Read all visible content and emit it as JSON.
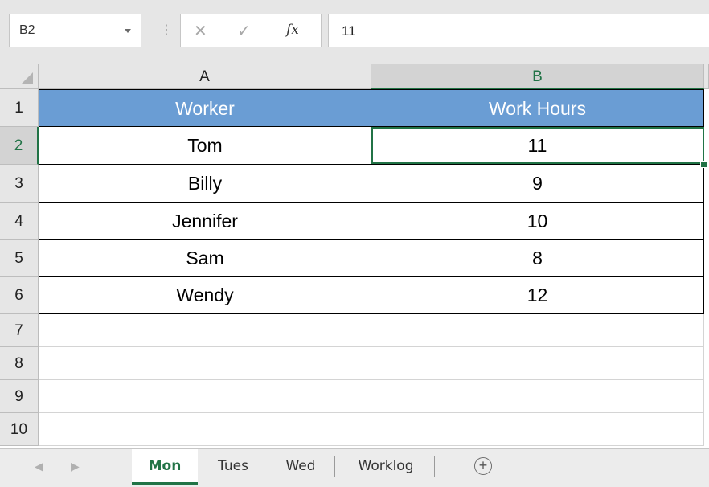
{
  "formula_bar": {
    "name_box": "B2",
    "cancel_symbol": "✕",
    "enter_symbol": "✓",
    "fx_label": "fx",
    "formula_value": "11"
  },
  "columns": [
    "A",
    "B"
  ],
  "rows": [
    "1",
    "2",
    "3",
    "4",
    "5",
    "6",
    "7",
    "8",
    "9",
    "10"
  ],
  "table": {
    "headers": [
      "Worker",
      "Work Hours"
    ],
    "data": [
      [
        "Tom",
        "11"
      ],
      [
        "Billy",
        "9"
      ],
      [
        "Jennifer",
        "10"
      ],
      [
        "Sam",
        "8"
      ],
      [
        "Wendy",
        "12"
      ]
    ]
  },
  "sheet_tabs": [
    "Mon",
    "Tues",
    "Wed",
    "Worklog"
  ],
  "active_tab": "Mon",
  "active_cell": "B2",
  "add_sheet_symbol": "+",
  "nav": {
    "prev": "◀",
    "next": "▶"
  },
  "colors": {
    "header_fill": "#6a9dd4",
    "accent": "#217346"
  }
}
